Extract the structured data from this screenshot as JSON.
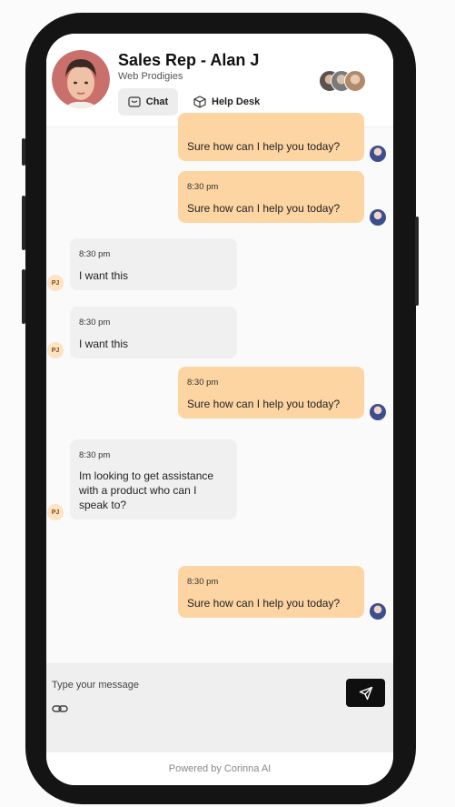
{
  "header": {
    "title": "Sales Rep - Alan J",
    "subtitle": "Web Prodigies",
    "tabs": [
      {
        "label": "Chat",
        "icon": "chat-icon",
        "active": true
      },
      {
        "label": "Help Desk",
        "icon": "box-icon",
        "active": false
      }
    ]
  },
  "messages": [
    {
      "sender": "outgoing",
      "time": "",
      "text": "Sure how can I help you today?"
    },
    {
      "sender": "outgoing",
      "time": "8:30 pm",
      "text": "Sure how can I help you today?"
    },
    {
      "sender": "incoming",
      "initials": "PJ",
      "time": "8:30 pm",
      "text": "I want this"
    },
    {
      "sender": "incoming",
      "initials": "PJ",
      "time": "8:30 pm",
      "text": "I want this"
    },
    {
      "sender": "outgoing",
      "time": "8:30 pm",
      "text": "Sure how can I help you today?"
    },
    {
      "sender": "incoming",
      "initials": "PJ",
      "time": "8:30 pm",
      "lines": [
        "Im looking to get assistance",
        "with a product who can I",
        "speak to?"
      ]
    },
    {
      "sender": "outgoing",
      "time": "8:30 pm",
      "text": "Sure how can I help you today?"
    }
  ],
  "composer": {
    "placeholder": "Type your message"
  },
  "footer": {
    "powered_by": "Powered by Corinna AI"
  },
  "colors": {
    "outgoing_bubble": "#fdd5a3",
    "incoming_bubble": "#f0f0f0",
    "send_button": "#0f0f0f"
  }
}
